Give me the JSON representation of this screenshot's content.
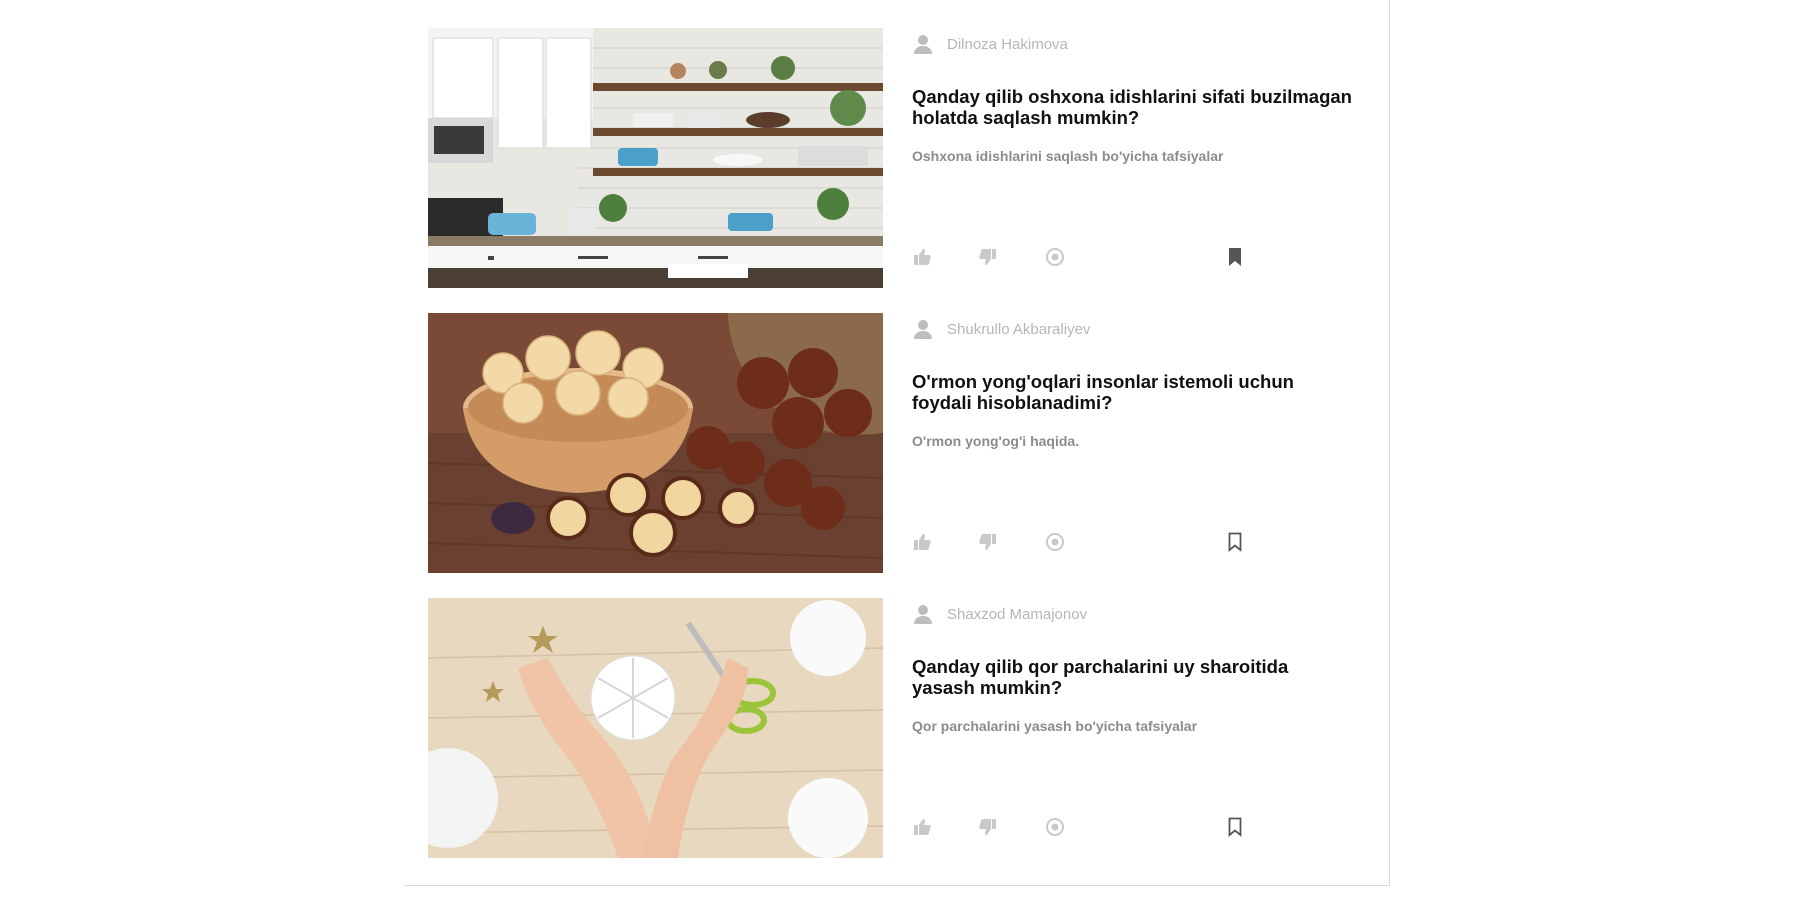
{
  "posts": [
    {
      "author": "Dilnoza Hakimova",
      "title": "Qanday qilib oshxona idishlarini sifati buzilmagan holatda saqlash mumkin?",
      "description": "Oshxona idishlarini saqlash bo'yicha tafsiyalar",
      "image_icon": "kitchen-shelves-photo",
      "bookmarked": true
    },
    {
      "author": "Shukrullo Akbaraliyev",
      "title": "O'rmon yong'oqlari insonlar istemoli uchun foydali hisoblanadimi?",
      "description": "O'rmon yong'og'i haqida.",
      "image_icon": "macadamia-nuts-photo",
      "bookmarked": false
    },
    {
      "author": "Shaxzod Mamajonov",
      "title": "Qanday qilib qor parchalarini uy sharoitida yasash mumkin?",
      "description": "Qor parchalarini yasash bo'yicha tafsiyalar",
      "image_icon": "paper-snowflake-photo",
      "bookmarked": false
    }
  ],
  "icons": {
    "user": "user-icon",
    "like": "thumbs-up-icon",
    "dislike": "thumbs-down-icon",
    "views": "eye-icon",
    "bookmark": "bookmark-icon"
  },
  "colors": {
    "icon_muted": "#c9c9c9",
    "icon_dark": "#555555",
    "author": "#b6b6b6",
    "title": "#111111",
    "description": "#8c8c8c"
  }
}
